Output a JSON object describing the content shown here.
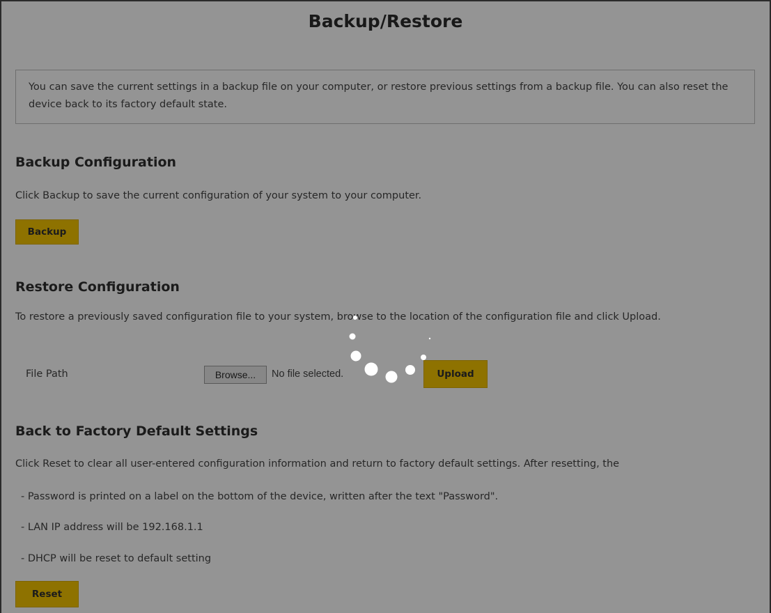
{
  "page": {
    "title": "Backup/Restore",
    "info": "You can save the current settings in a backup file on your computer, or restore previous settings from a backup file. You can also reset the device back to its factory default state."
  },
  "backup": {
    "title": "Backup Configuration",
    "description": "Click Backup to save the current configuration of your system to your computer.",
    "button_label": "Backup"
  },
  "restore": {
    "title": "Restore Configuration",
    "description": "To restore a previously saved configuration file to your system, browse to the location of the configuration file and click Upload.",
    "file_path_label": "File Path",
    "browse_label": "Browse...",
    "file_status": "No file selected.",
    "upload_label": "Upload"
  },
  "factory": {
    "title": "Back to Factory Default Settings",
    "description": "Click Reset to clear all user-entered configuration information and return to factory default settings. After resetting, the",
    "notes": [
      "- Password is printed on a label on the bottom of the device, written after the text \"Password\".",
      "- LAN IP address will be 192.168.1.1",
      "- DHCP will be reset to default setting"
    ],
    "reset_label": "Reset"
  },
  "colors": {
    "accent_button": "#f5c400",
    "overlay": "rgba(0,0,0,0.42)"
  },
  "icons": {
    "loading": "loading-spinner-icon"
  }
}
